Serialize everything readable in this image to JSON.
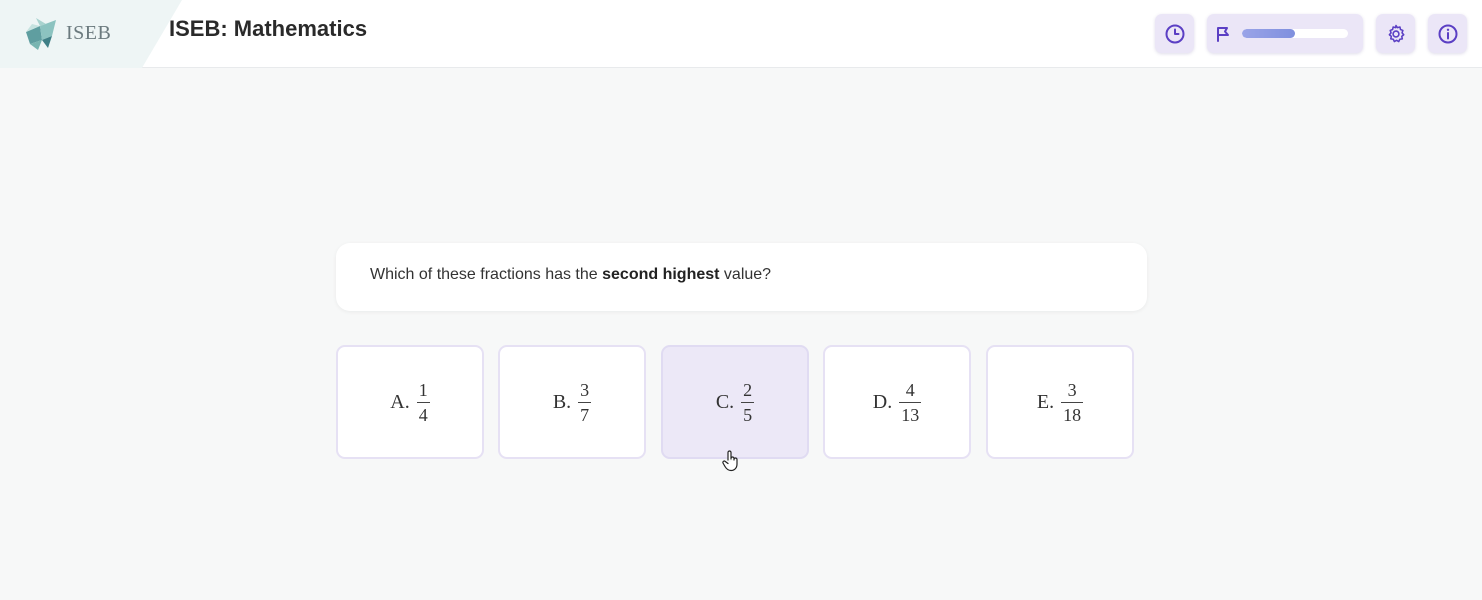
{
  "header": {
    "logo_text": "ISEB",
    "title": "ISEB: Mathematics",
    "progress_fraction": 0.5
  },
  "question": {
    "prefix": "Which of these fractions has the ",
    "emphasis": "second highest",
    "suffix": " value?"
  },
  "options": [
    {
      "letter": "A.",
      "numerator": "1",
      "denominator": "4"
    },
    {
      "letter": "B.",
      "numerator": "3",
      "denominator": "7"
    },
    {
      "letter": "C.",
      "numerator": "2",
      "denominator": "5"
    },
    {
      "letter": "D.",
      "numerator": "4",
      "denominator": "13"
    },
    {
      "letter": "E.",
      "numerator": "3",
      "denominator": "18"
    }
  ],
  "icons": {
    "timer": "clock-icon",
    "flag": "flag-icon",
    "settings": "gear-icon",
    "info": "info-icon"
  },
  "colors": {
    "accent": "#5b3fc4",
    "button_bg": "#ebe6f7",
    "option_border": "#e6e1f4",
    "option_hover_bg": "#ece8f7"
  }
}
